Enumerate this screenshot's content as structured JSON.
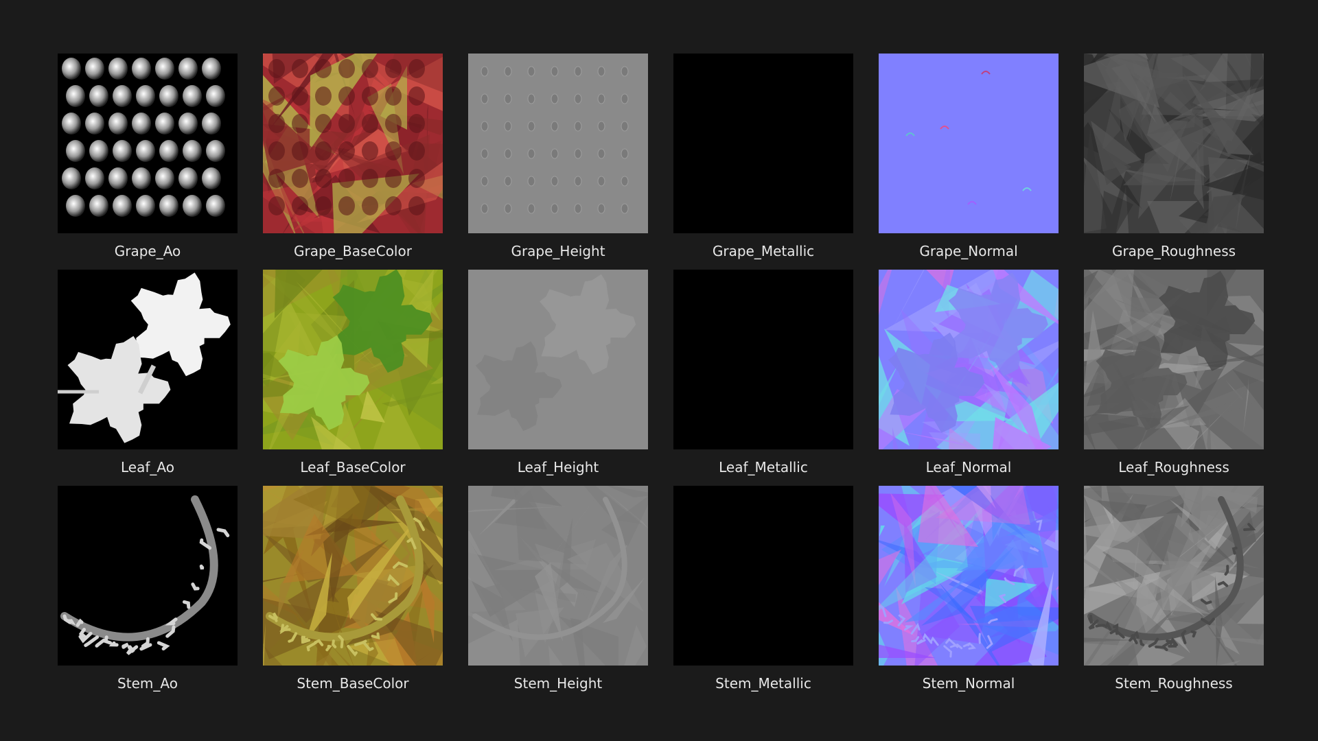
{
  "gallery": {
    "items": [
      {
        "name": "Grape_Ao",
        "icon": "grape-ao-thumbnail"
      },
      {
        "name": "Grape_BaseColor",
        "icon": "grape-basecolor-thumbnail"
      },
      {
        "name": "Grape_Height",
        "icon": "grape-height-thumbnail"
      },
      {
        "name": "Grape_Metallic",
        "icon": "grape-metallic-thumbnail"
      },
      {
        "name": "Grape_Normal",
        "icon": "grape-normal-thumbnail"
      },
      {
        "name": "Grape_Roughness",
        "icon": "grape-roughness-thumbnail"
      },
      {
        "name": "Leaf_Ao",
        "icon": "leaf-ao-thumbnail"
      },
      {
        "name": "Leaf_BaseColor",
        "icon": "leaf-basecolor-thumbnail"
      },
      {
        "name": "Leaf_Height",
        "icon": "leaf-height-thumbnail"
      },
      {
        "name": "Leaf_Metallic",
        "icon": "leaf-metallic-thumbnail"
      },
      {
        "name": "Leaf_Normal",
        "icon": "leaf-normal-thumbnail"
      },
      {
        "name": "Leaf_Roughness",
        "icon": "leaf-roughness-thumbnail"
      },
      {
        "name": "Stem_Ao",
        "icon": "stem-ao-thumbnail"
      },
      {
        "name": "Stem_BaseColor",
        "icon": "stem-basecolor-thumbnail"
      },
      {
        "name": "Stem_Height",
        "icon": "stem-height-thumbnail"
      },
      {
        "name": "Stem_Metallic",
        "icon": "stem-metallic-thumbnail"
      },
      {
        "name": "Stem_Normal",
        "icon": "stem-normal-thumbnail"
      },
      {
        "name": "Stem_Roughness",
        "icon": "stem-roughness-thumbnail"
      }
    ]
  },
  "colors": {
    "background": "#1b1b1b",
    "label_text": "#e8e8e8",
    "normal_map_base": "#8080ff",
    "metallic": "#000000",
    "height_gray": "#8a8a8a",
    "grape_basecolor": "#9e2a30",
    "leaf_basecolor": "#8ea41c",
    "stem_basecolor": "#9a8a2a",
    "roughness_gray": "#6a6a6a"
  }
}
